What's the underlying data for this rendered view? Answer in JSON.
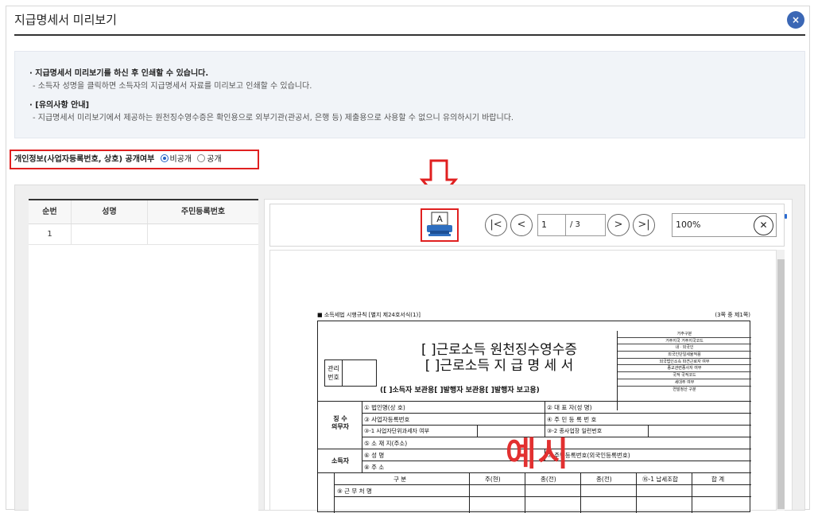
{
  "dialog": {
    "title": "지급명세서 미리보기",
    "close_label": "×"
  },
  "info": {
    "line1": "지급명세서 미리보기를 하신 후 인쇄할 수 있습니다.",
    "line2": "- 소득자 성명을 클릭하면 소득자의 지급명세서 자료를 미리보고 인쇄할 수 있습니다.",
    "line3": "[유의사항 안내]",
    "line4": "- 지급명세서 미리보기에서 제공하는 원천징수영수증은 확인용으로 외부기관(관공서, 은행 등) 제출용으로 사용할 수 없으니 유의하시기 바랍니다."
  },
  "privacy": {
    "label": "개인정보(사업자등록번호, 상호) 공개여부",
    "option_private": "비공개",
    "option_public": "공개",
    "selected": "비공개"
  },
  "list": {
    "headers": [
      "순번",
      "성명",
      "주민등록번호"
    ],
    "rows": [
      [
        "1",
        "",
        ""
      ]
    ]
  },
  "viewer": {
    "page_current": "1",
    "page_total": "/ 3",
    "zoom": "100%",
    "print_letter": "A"
  },
  "form": {
    "header_left": "■ 소득세법 시행규칙 [별지 제24호서식(1)]",
    "header_right": "(3쪽 중 제1쪽)",
    "title1": "[   ]근로소득 원천징수영수증",
    "title2": "[   ]근로소득 지 급 명 세 서",
    "subtitle": "([   ]소득자 보관용[   ]발행자 보관용[   ]발행자 보고용)",
    "mgmt": "관리번호",
    "right_rows": [
      "거주구분",
      "거주지국   거주지국코드",
      "내ㆍ외국인",
      "외국인단일세율적용",
      "외국법인소속 파견근로자 여부",
      "종교관련종사자 여부",
      "국적        국적코드",
      "세대주 여부",
      "연말정산 구분"
    ],
    "withholder_label": "징 수\n의무자",
    "earner_label": "소득자",
    "c1": "① 법인명(상 호)",
    "c2": "② 대 표 자(성 명)",
    "c3": "③ 사업자등록번호",
    "c4": "④ 주 민 등 록 번 호",
    "c5": "③-1 사업자단위과세자 여부",
    "c6": "③-2 종사업장 일련번호",
    "c7": "⑤ 소 재 지(주소)",
    "c8": "⑥ 성       명",
    "c9": "⑦ 주민등록번호(외국인등록번호)",
    "c10": "⑧ 주       소",
    "table_headers": [
      "구 분",
      "주(현)",
      "종(전)",
      "종(전)",
      "⑯-1 납세조합",
      "합  계"
    ],
    "row1": "⑨ 근 무 처 명",
    "watermark": "예시"
  }
}
